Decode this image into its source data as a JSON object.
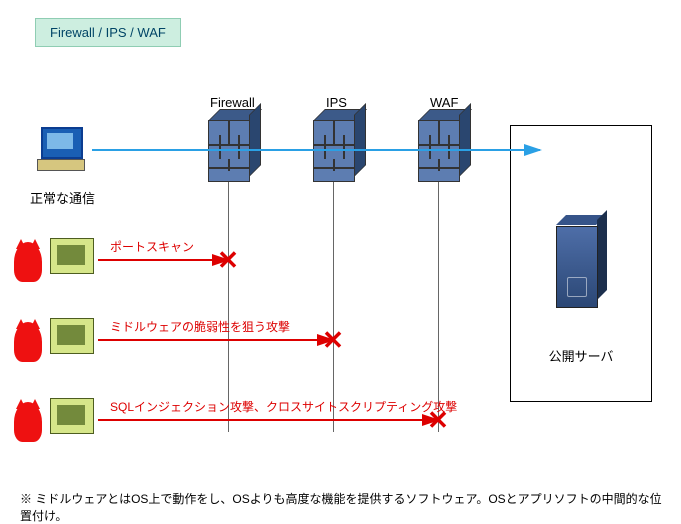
{
  "title": "Firewall / IPS /  WAF",
  "columns": {
    "firewall": "Firewall",
    "ips": "IPS",
    "waf": "WAF"
  },
  "client_label": "正常な通信",
  "server_label": "公開サーバ",
  "attacks": [
    {
      "label": "ポートスキャン",
      "blocked_by": "firewall"
    },
    {
      "label": "ミドルウェアの脆弱性を狙う攻撃",
      "blocked_by": "ips"
    },
    {
      "label": "SQLインジェクション攻撃、クロスサイトスクリプティング攻撃",
      "blocked_by": "waf"
    }
  ],
  "footnote": "※  ミドルウェアとはOS上で動作をし、OSよりも高度な機能を提供するソフトウェア。OSとアプリソフトの中間的な位置付け。",
  "colors": {
    "blue_arrow": "#2aa0e5",
    "red": "#d00",
    "title_bg": "#cdeee0"
  }
}
